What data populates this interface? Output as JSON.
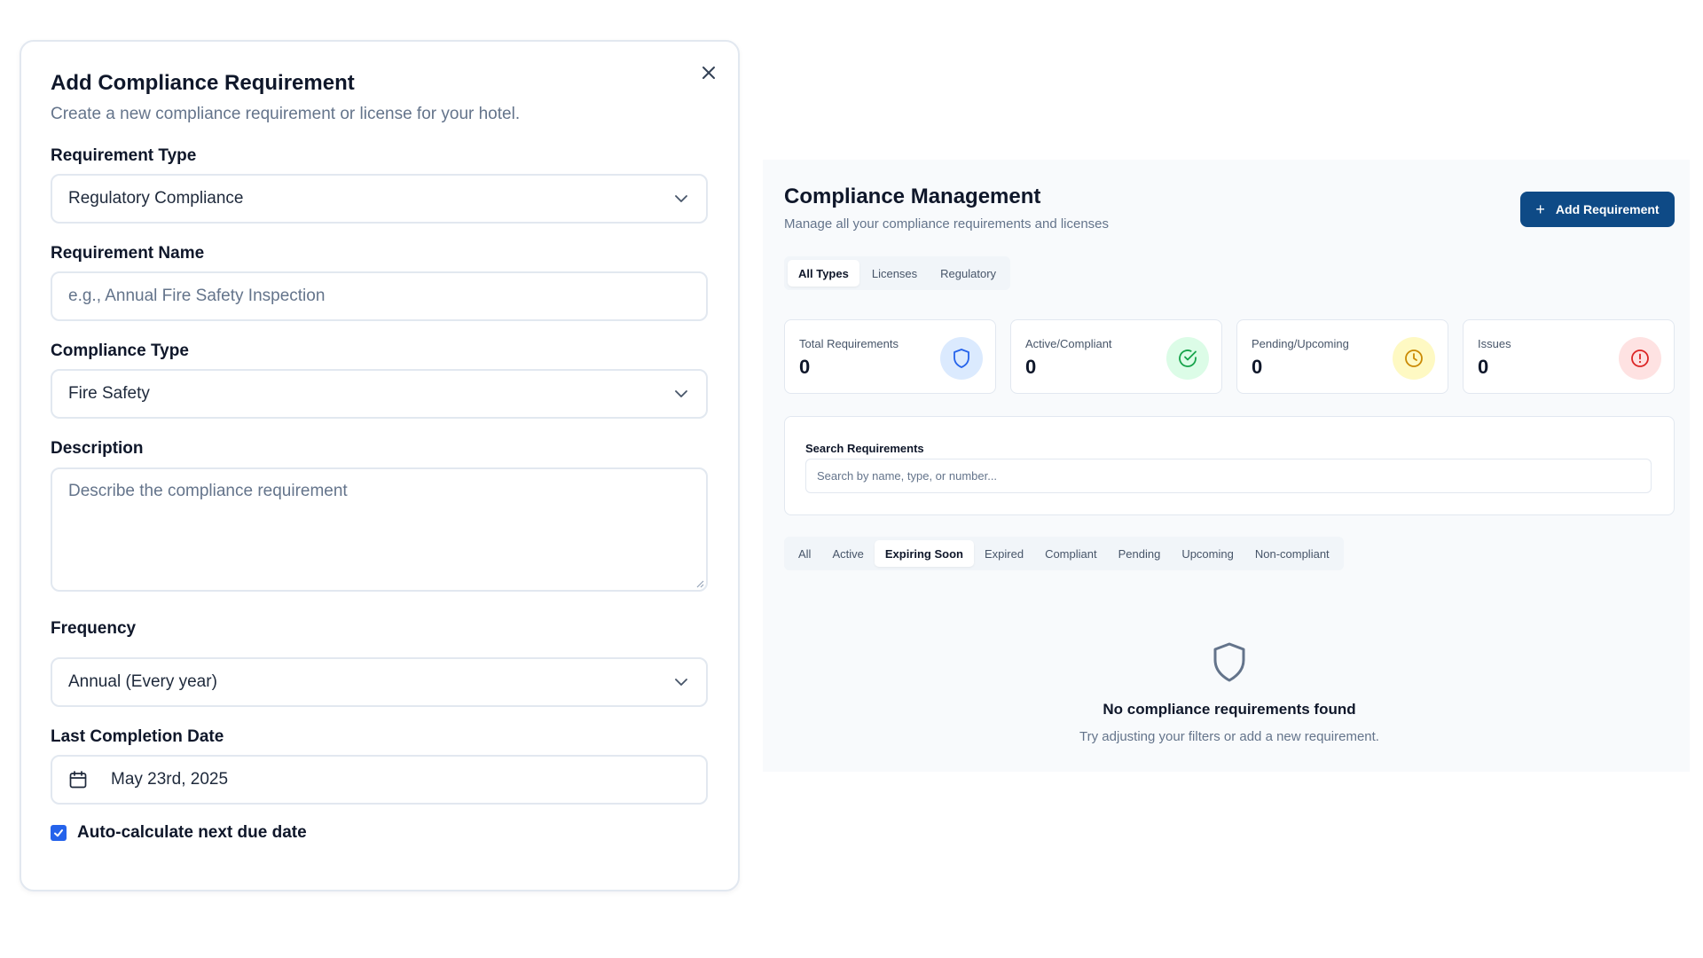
{
  "modal": {
    "title": "Add Compliance Requirement",
    "subtitle": "Create a new compliance requirement or license for your hotel.",
    "close_icon": "close-icon",
    "requirement_type": {
      "label": "Requirement Type",
      "value": "Regulatory Compliance"
    },
    "requirement_name": {
      "label": "Requirement Name",
      "placeholder": "e.g., Annual Fire Safety Inspection"
    },
    "compliance_type": {
      "label": "Compliance Type",
      "value": "Fire Safety"
    },
    "description": {
      "label": "Description",
      "placeholder": "Describe the compliance requirement"
    },
    "frequency": {
      "label": "Frequency",
      "value": "Annual (Every year)"
    },
    "last_completion_date": {
      "label": "Last Completion Date",
      "value": "May 23rd, 2025"
    },
    "auto_calculate": {
      "label": "Auto-calculate next due date",
      "checked": true
    }
  },
  "panel": {
    "title": "Compliance Management",
    "subtitle": "Manage all your compliance requirements and licenses",
    "add_button": "Add Requirement",
    "type_tabs": [
      "All Types",
      "Licenses",
      "Regulatory"
    ],
    "type_tab_active": "All Types",
    "stats": [
      {
        "label": "Total Requirements",
        "value": "0",
        "icon": "shield-icon",
        "color": "#2563eb",
        "bg": "#dbeafe"
      },
      {
        "label": "Active/Compliant",
        "value": "0",
        "icon": "check-circle-icon",
        "color": "#16a34a",
        "bg": "#dcfce7"
      },
      {
        "label": "Pending/Upcoming",
        "value": "0",
        "icon": "clock-icon",
        "color": "#ca8a04",
        "bg": "#fef9c3"
      },
      {
        "label": "Issues",
        "value": "0",
        "icon": "alert-circle-icon",
        "color": "#dc2626",
        "bg": "#fee2e2"
      }
    ],
    "search": {
      "label": "Search Requirements",
      "placeholder": "Search by name, type, or number..."
    },
    "status_tabs": [
      "All",
      "Active",
      "Expiring Soon",
      "Expired",
      "Compliant",
      "Pending",
      "Upcoming",
      "Non-compliant"
    ],
    "status_tab_active": "Expiring Soon",
    "empty": {
      "icon": "shield-icon",
      "title": "No compliance requirements found",
      "subtitle": "Try adjusting your filters or add a new requirement."
    }
  },
  "colors": {
    "primary_button": "#0e4a86",
    "checkbox": "#2563eb"
  }
}
